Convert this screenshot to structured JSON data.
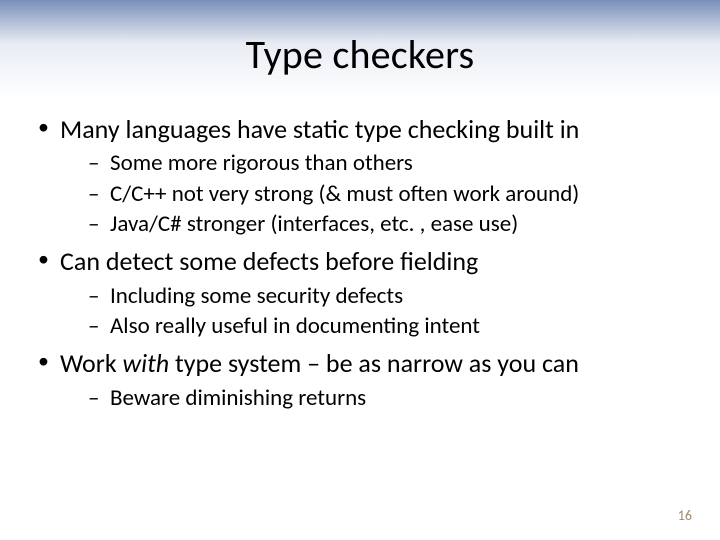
{
  "title": "Type checkers",
  "bullets": {
    "b1": "Many languages have static type checking built in",
    "b1_sub": [
      "Some more rigorous than others",
      "C/C++ not very strong (& must often work around)",
      "Java/C# stronger (interfaces, etc. , ease use)"
    ],
    "b2": "Can detect some defects before fielding",
    "b2_sub": [
      "Including some security defects",
      "Also really useful in documenting intent"
    ],
    "b3_prefix": "Work ",
    "b3_em": "with",
    "b3_suffix": " type system – be as narrow as you can",
    "b3_sub": [
      "Beware diminishing returns"
    ]
  },
  "page_number": "16"
}
